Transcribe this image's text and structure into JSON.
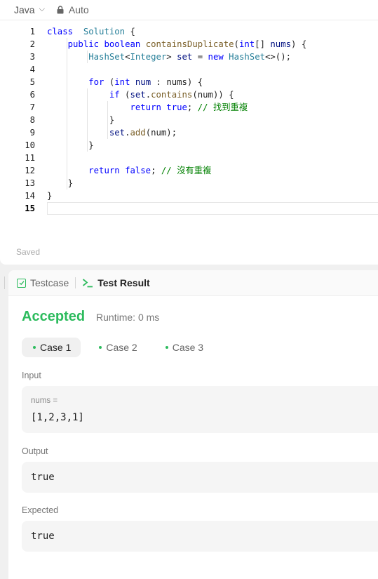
{
  "editor": {
    "language": "Java",
    "mode": "Auto",
    "status": "Saved",
    "lines": [
      {
        "n": "1",
        "tokens": [
          [
            "kw",
            "class"
          ],
          [
            "",
            "  "
          ],
          [
            "ty",
            "Solution"
          ],
          [
            "",
            " {"
          ]
        ]
      },
      {
        "n": "2",
        "tokens": [
          [
            "",
            "    "
          ],
          [
            "kw",
            "public"
          ],
          [
            "",
            " "
          ],
          [
            "kw",
            "boolean"
          ],
          [
            "",
            " "
          ],
          [
            "fn",
            "containsDuplicate"
          ],
          [
            "",
            "("
          ],
          [
            "kw",
            "int"
          ],
          [
            "",
            "[] "
          ],
          [
            "vr",
            "nums"
          ],
          [
            "",
            ") {"
          ]
        ]
      },
      {
        "n": "3",
        "tokens": [
          [
            "",
            "        "
          ],
          [
            "ty",
            "HashSet"
          ],
          [
            "",
            "<"
          ],
          [
            "ty",
            "Integer"
          ],
          [
            "",
            "> "
          ],
          [
            "vr",
            "set"
          ],
          [
            "",
            " = "
          ],
          [
            "kw",
            "new"
          ],
          [
            "",
            " "
          ],
          [
            "ty",
            "HashSet"
          ],
          [
            "",
            "<>();"
          ]
        ]
      },
      {
        "n": "4",
        "tokens": []
      },
      {
        "n": "5",
        "tokens": [
          [
            "",
            "        "
          ],
          [
            "kw",
            "for"
          ],
          [
            "",
            " ("
          ],
          [
            "kw",
            "int"
          ],
          [
            "",
            " "
          ],
          [
            "vr",
            "num"
          ],
          [
            "",
            " : nums) {"
          ]
        ]
      },
      {
        "n": "6",
        "tokens": [
          [
            "",
            "            "
          ],
          [
            "kw",
            "if"
          ],
          [
            "",
            " ("
          ],
          [
            "vr",
            "set"
          ],
          [
            "",
            "."
          ],
          [
            "fn",
            "contains"
          ],
          [
            "",
            "(num)) {"
          ]
        ]
      },
      {
        "n": "7",
        "tokens": [
          [
            "",
            "                "
          ],
          [
            "kw",
            "return"
          ],
          [
            "",
            " "
          ],
          [
            "kw",
            "true"
          ],
          [
            "",
            "; "
          ],
          [
            "cm",
            "// 找到重複"
          ]
        ]
      },
      {
        "n": "8",
        "tokens": [
          [
            "",
            "            }"
          ]
        ]
      },
      {
        "n": "9",
        "tokens": [
          [
            "",
            "            "
          ],
          [
            "vr",
            "set"
          ],
          [
            "",
            "."
          ],
          [
            "fn",
            "add"
          ],
          [
            "",
            "(num);"
          ]
        ]
      },
      {
        "n": "10",
        "tokens": [
          [
            "",
            "        }"
          ]
        ]
      },
      {
        "n": "11",
        "tokens": []
      },
      {
        "n": "12",
        "tokens": [
          [
            "",
            "        "
          ],
          [
            "kw",
            "return"
          ],
          [
            "",
            " "
          ],
          [
            "kw",
            "false"
          ],
          [
            "",
            "; "
          ],
          [
            "cm",
            "// 沒有重複"
          ]
        ]
      },
      {
        "n": "13",
        "tokens": [
          [
            "",
            "    }"
          ]
        ]
      },
      {
        "n": "14",
        "tokens": [
          [
            "",
            "}"
          ]
        ]
      },
      {
        "n": "15",
        "tokens": []
      }
    ]
  },
  "result_panel": {
    "tabs": {
      "testcase": "Testcase",
      "test_result": "Test Result"
    },
    "verdict": "Accepted",
    "runtime": "Runtime: 0 ms",
    "cases": [
      "Case 1",
      "Case 2",
      "Case 3"
    ],
    "input_label": "Input",
    "input_key": "nums =",
    "input_value": "[1,2,3,1]",
    "output_label": "Output",
    "output_value": "true",
    "expected_label": "Expected",
    "expected_value": "true"
  },
  "colors": {
    "accent_green": "#2cbb5d",
    "keyword": "#0000ff",
    "type": "#267f99",
    "function": "#795e26",
    "variable": "#001080",
    "comment": "#008000"
  }
}
